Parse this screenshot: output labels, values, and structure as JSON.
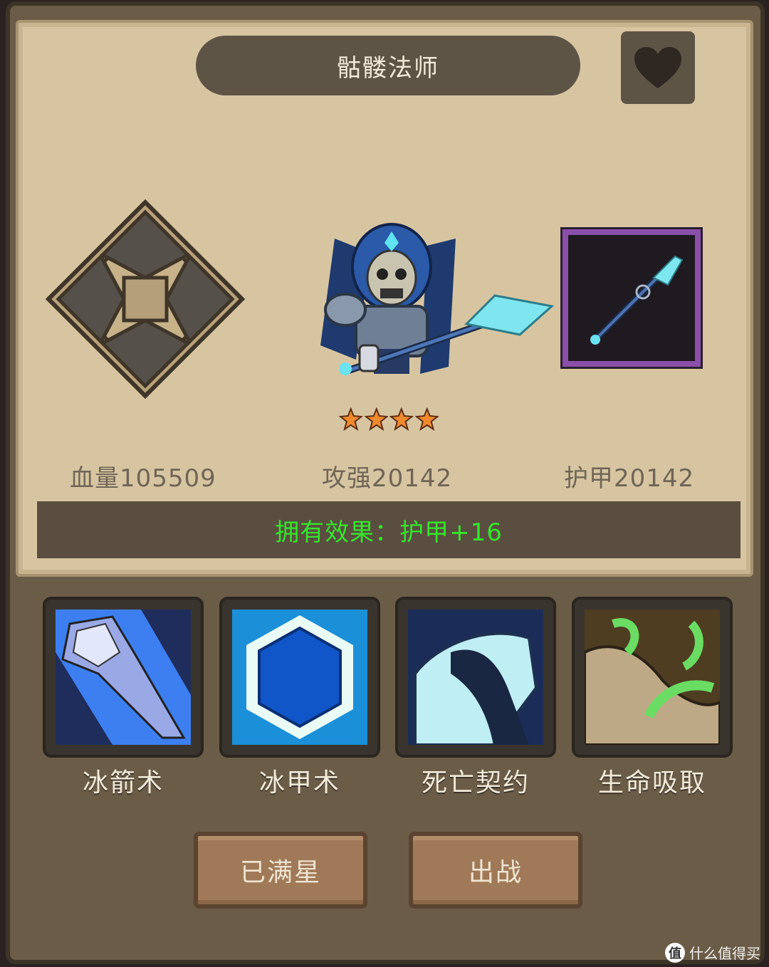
{
  "hero": {
    "name": "骷髅法师",
    "stars": 4
  },
  "stats": {
    "hp": "血量105509",
    "attack": "攻强20142",
    "armor": "护甲20142"
  },
  "effect": "拥有效果：护甲+16",
  "skills": [
    {
      "name": "冰箭术",
      "icon": "ice-arrow-icon"
    },
    {
      "name": "冰甲术",
      "icon": "ice-armor-icon"
    },
    {
      "name": "死亡契约",
      "icon": "death-pact-icon"
    },
    {
      "name": "生命吸取",
      "icon": "life-drain-icon"
    }
  ],
  "buttons": {
    "max_star": "已满星",
    "deploy": "出战"
  },
  "watermark": {
    "badge": "值",
    "text": "什么值得买"
  },
  "colors": {
    "effect_text": "#34e62b",
    "star": "#f08a2e",
    "weapon_frame": "#8a4fa8"
  }
}
